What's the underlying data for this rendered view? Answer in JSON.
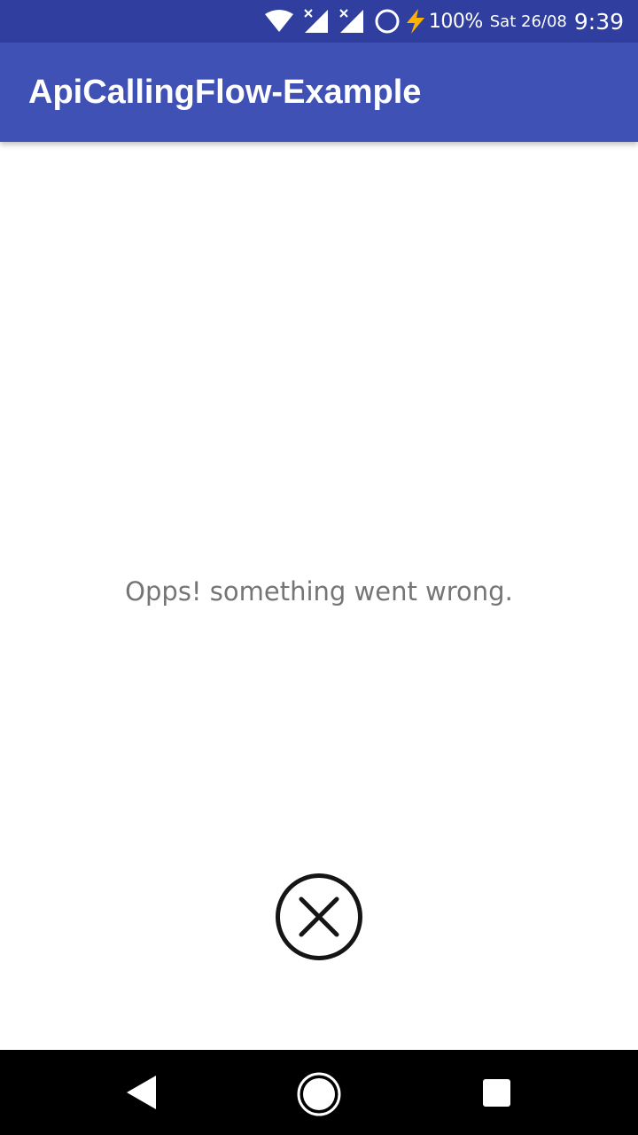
{
  "status_bar": {
    "battery": "100%",
    "date": "Sat 26/08",
    "time": "9:39",
    "icons": [
      "wifi-icon",
      "signal-no-sim-icon",
      "signal-no-sim-icon",
      "do-not-disturb-icon",
      "charging-bolt-icon"
    ],
    "bolt_color": "#ffb300"
  },
  "app_bar": {
    "title": "ApiCallingFlow-Example",
    "color": "#3f51b5"
  },
  "main": {
    "error_message": "Opps! something went wrong.",
    "close_icon": "close-circle-icon"
  },
  "nav_bar": {
    "icons": [
      "back-icon",
      "home-icon",
      "recents-icon"
    ]
  }
}
